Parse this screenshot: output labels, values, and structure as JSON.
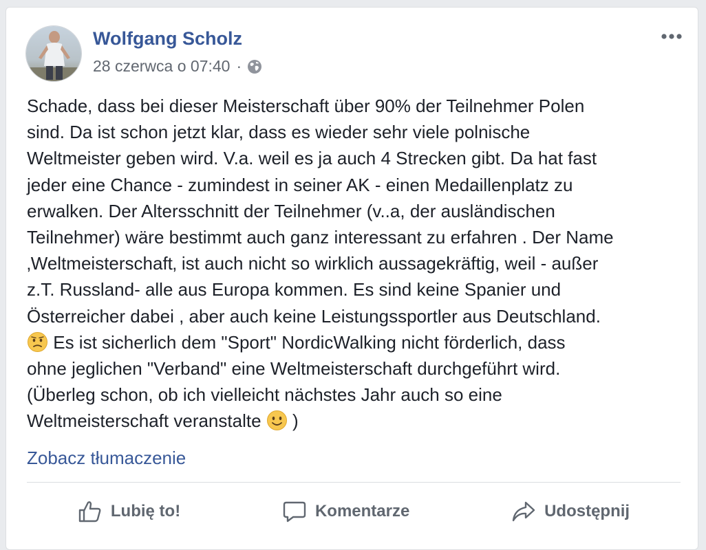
{
  "post": {
    "author": "Wolfgang Scholz",
    "timestamp": "28 czerwca o 07:40",
    "separator": "·",
    "privacy_icon": "globe-icon",
    "text_lines": [
      "Schade, dass bei dieser Meisterschaft über 90% der Teilnehmer Polen",
      "sind. Da ist schon jetzt klar, dass es wieder sehr viele polnische",
      "Weltmeister geben wird. V.a. weil es ja auch 4 Strecken gibt. Da hat fast",
      "jeder eine Chance - zumindest in seiner AK - einen Medaillenplatz zu",
      "erwalken. Der Altersschnitt der Teilnehmer (v..a, der ausländischen",
      "Teilnehmer) wäre bestimmt auch ganz interessant zu erfahren . Der Name",
      "‚Weltmeisterschaft‚ ist auch nicht so wirklich aussagekräftig, weil - außer",
      "z.T. Russland- alle aus Europa kommen. Es sind keine Spanier und",
      "Österreicher dabei , aber auch keine Leistungssportler aus Deutschland.",
      " Es ist sicherlich dem \"Sport\" NordicWalking nicht förderlich, dass",
      "ohne jeglichen \"Verband\" eine Weltmeisterschaft durchgeführt wird.",
      "(Überleg schon, ob ich vielleicht nächstes Jahr auch so eine",
      "Weltmeisterschaft veranstalte ",
      " )"
    ],
    "see_translation": "Zobacz tłumaczenie"
  },
  "actions": {
    "like_label": "Lubię to!",
    "comment_label": "Komentarze",
    "share_label": "Udostępnij"
  },
  "icons": {
    "like": "thumbs-up-icon",
    "comment": "speech-bubble-icon",
    "share": "share-arrow-icon",
    "more": "more-options-icon",
    "emoji_1": "worried-face-emoji",
    "emoji_2": "slightly-smiling-face-emoji"
  },
  "colors": {
    "link": "#385898",
    "text": "#1d2129",
    "meta": "#616770",
    "action": "#606770",
    "background": "#e9ebee"
  }
}
